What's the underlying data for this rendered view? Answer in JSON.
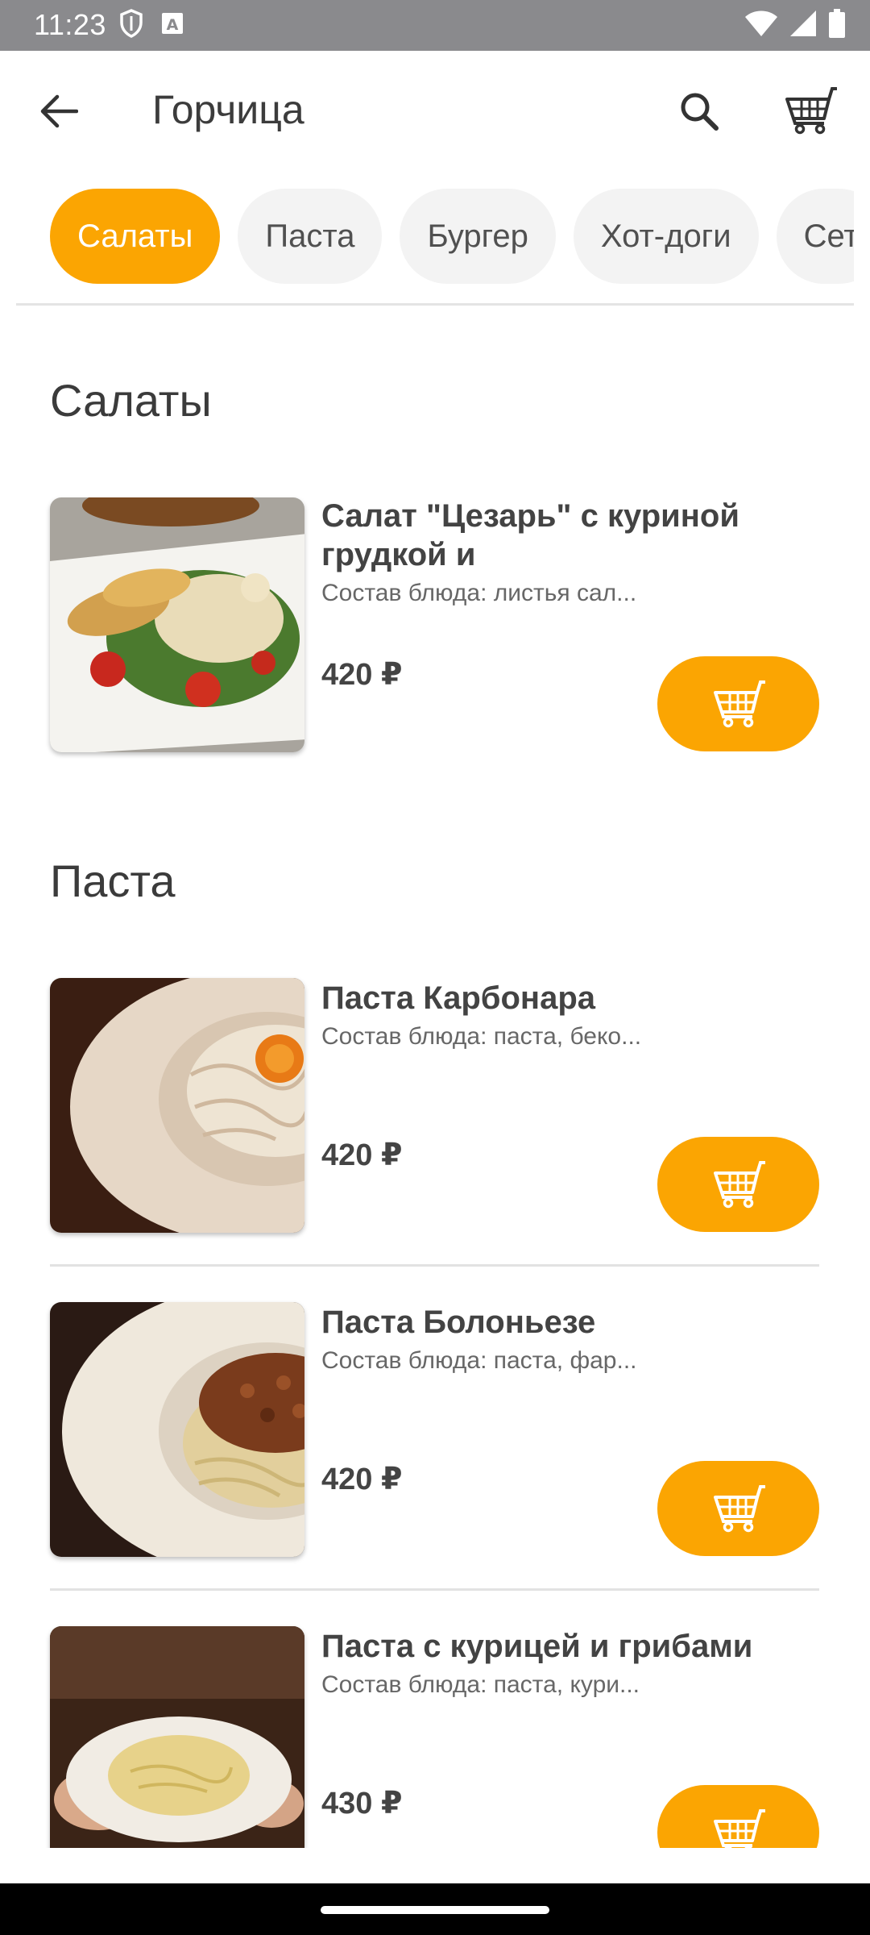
{
  "status_bar": {
    "time": "11:23",
    "icons": [
      "shield-icon",
      "font-a-icon",
      "wifi-icon",
      "signal-icon",
      "battery-icon"
    ]
  },
  "app_bar": {
    "title": "Горчица",
    "icons": [
      "back-arrow-icon",
      "search-icon",
      "cart-icon"
    ]
  },
  "categories": [
    {
      "label": "Салаты",
      "active": true
    },
    {
      "label": "Паста",
      "active": false
    },
    {
      "label": "Бургер",
      "active": false
    },
    {
      "label": "Хот-доги",
      "active": false
    },
    {
      "label": "Сет",
      "active": false
    }
  ],
  "sections": [
    {
      "title": "Салаты",
      "items": [
        {
          "name": "Салат \"Цезарь\" с куриной грудкой и",
          "description": "Состав блюда: листья сал...",
          "price": "420 ₽",
          "image": "caesar-salad-photo"
        }
      ]
    },
    {
      "title": "Паста",
      "items": [
        {
          "name": "Паста Карбонара",
          "description": "Состав блюда: паста, беко...",
          "price": "420 ₽",
          "image": "carbonara-photo"
        },
        {
          "name": "Паста Болоньезе",
          "description": "Состав блюда: паста,  фар...",
          "price": "420 ₽",
          "image": "bolognese-photo"
        },
        {
          "name": "Паста с курицей и грибами",
          "description": "Состав блюда: паста, кури...",
          "price": "430 ₽",
          "image": "chicken-mushroom-pasta-photo"
        }
      ]
    }
  ],
  "colors": {
    "accent": "#fba502",
    "status_bar": "#8a8a8d",
    "chip_inactive": "#f3f3f3",
    "text_primary": "#434343",
    "text_secondary": "#676767"
  }
}
